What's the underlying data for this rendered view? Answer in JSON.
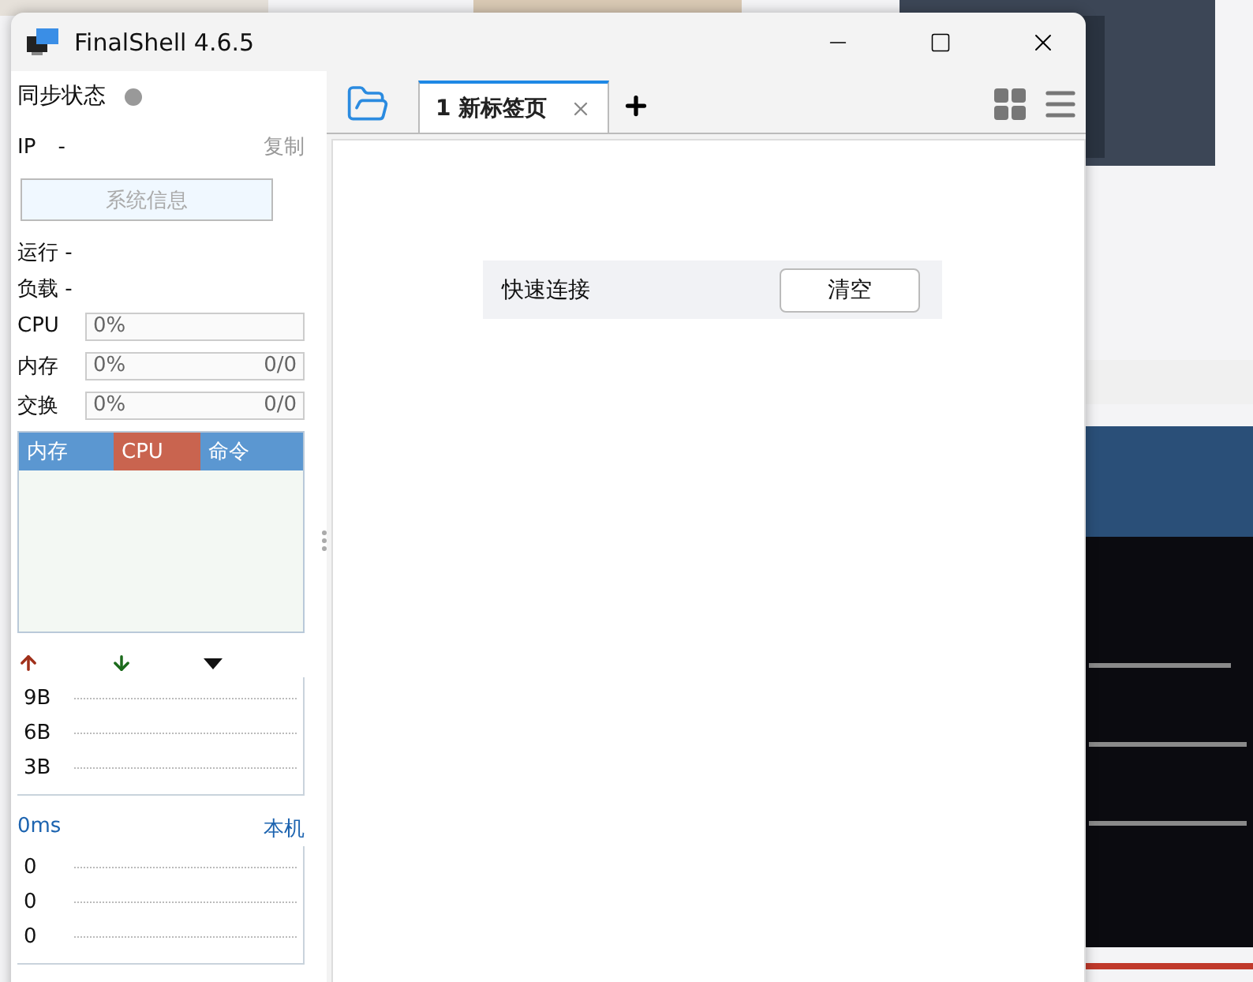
{
  "window": {
    "title": "FinalShell 4.6.5"
  },
  "sidebar": {
    "sync_label": "同步状态",
    "connected": false,
    "ip_label": "IP",
    "ip_value": "-",
    "copy_link": "复制",
    "sysinfo_button": "系统信息",
    "stats": [
      {
        "label": "运行 -"
      },
      {
        "label": "负载 -"
      }
    ],
    "meters": [
      {
        "label": "CPU",
        "percent": "0%",
        "level": 0
      },
      {
        "label": "内存",
        "percent": "0%",
        "amount": "0/0",
        "level": 0
      },
      {
        "label": "交换",
        "percent": "0%",
        "amount": "0/0",
        "level": 0
      }
    ],
    "process_table": {
      "columns": [
        {
          "label": "内存",
          "selected": false
        },
        {
          "label": "CPU",
          "selected": true
        },
        {
          "label": "命令",
          "selected": false
        }
      ]
    },
    "network": {
      "y_labels": [
        "9B",
        "6B",
        "3B"
      ]
    },
    "latency": {
      "value": "0ms",
      "host": "本机",
      "y_labels": [
        "0",
        "0",
        "0"
      ]
    }
  },
  "tabs": [
    {
      "label": "1 新标签页",
      "selected": true
    }
  ],
  "quick_connect": {
    "label": "快速连接",
    "clear_button": "清空"
  }
}
